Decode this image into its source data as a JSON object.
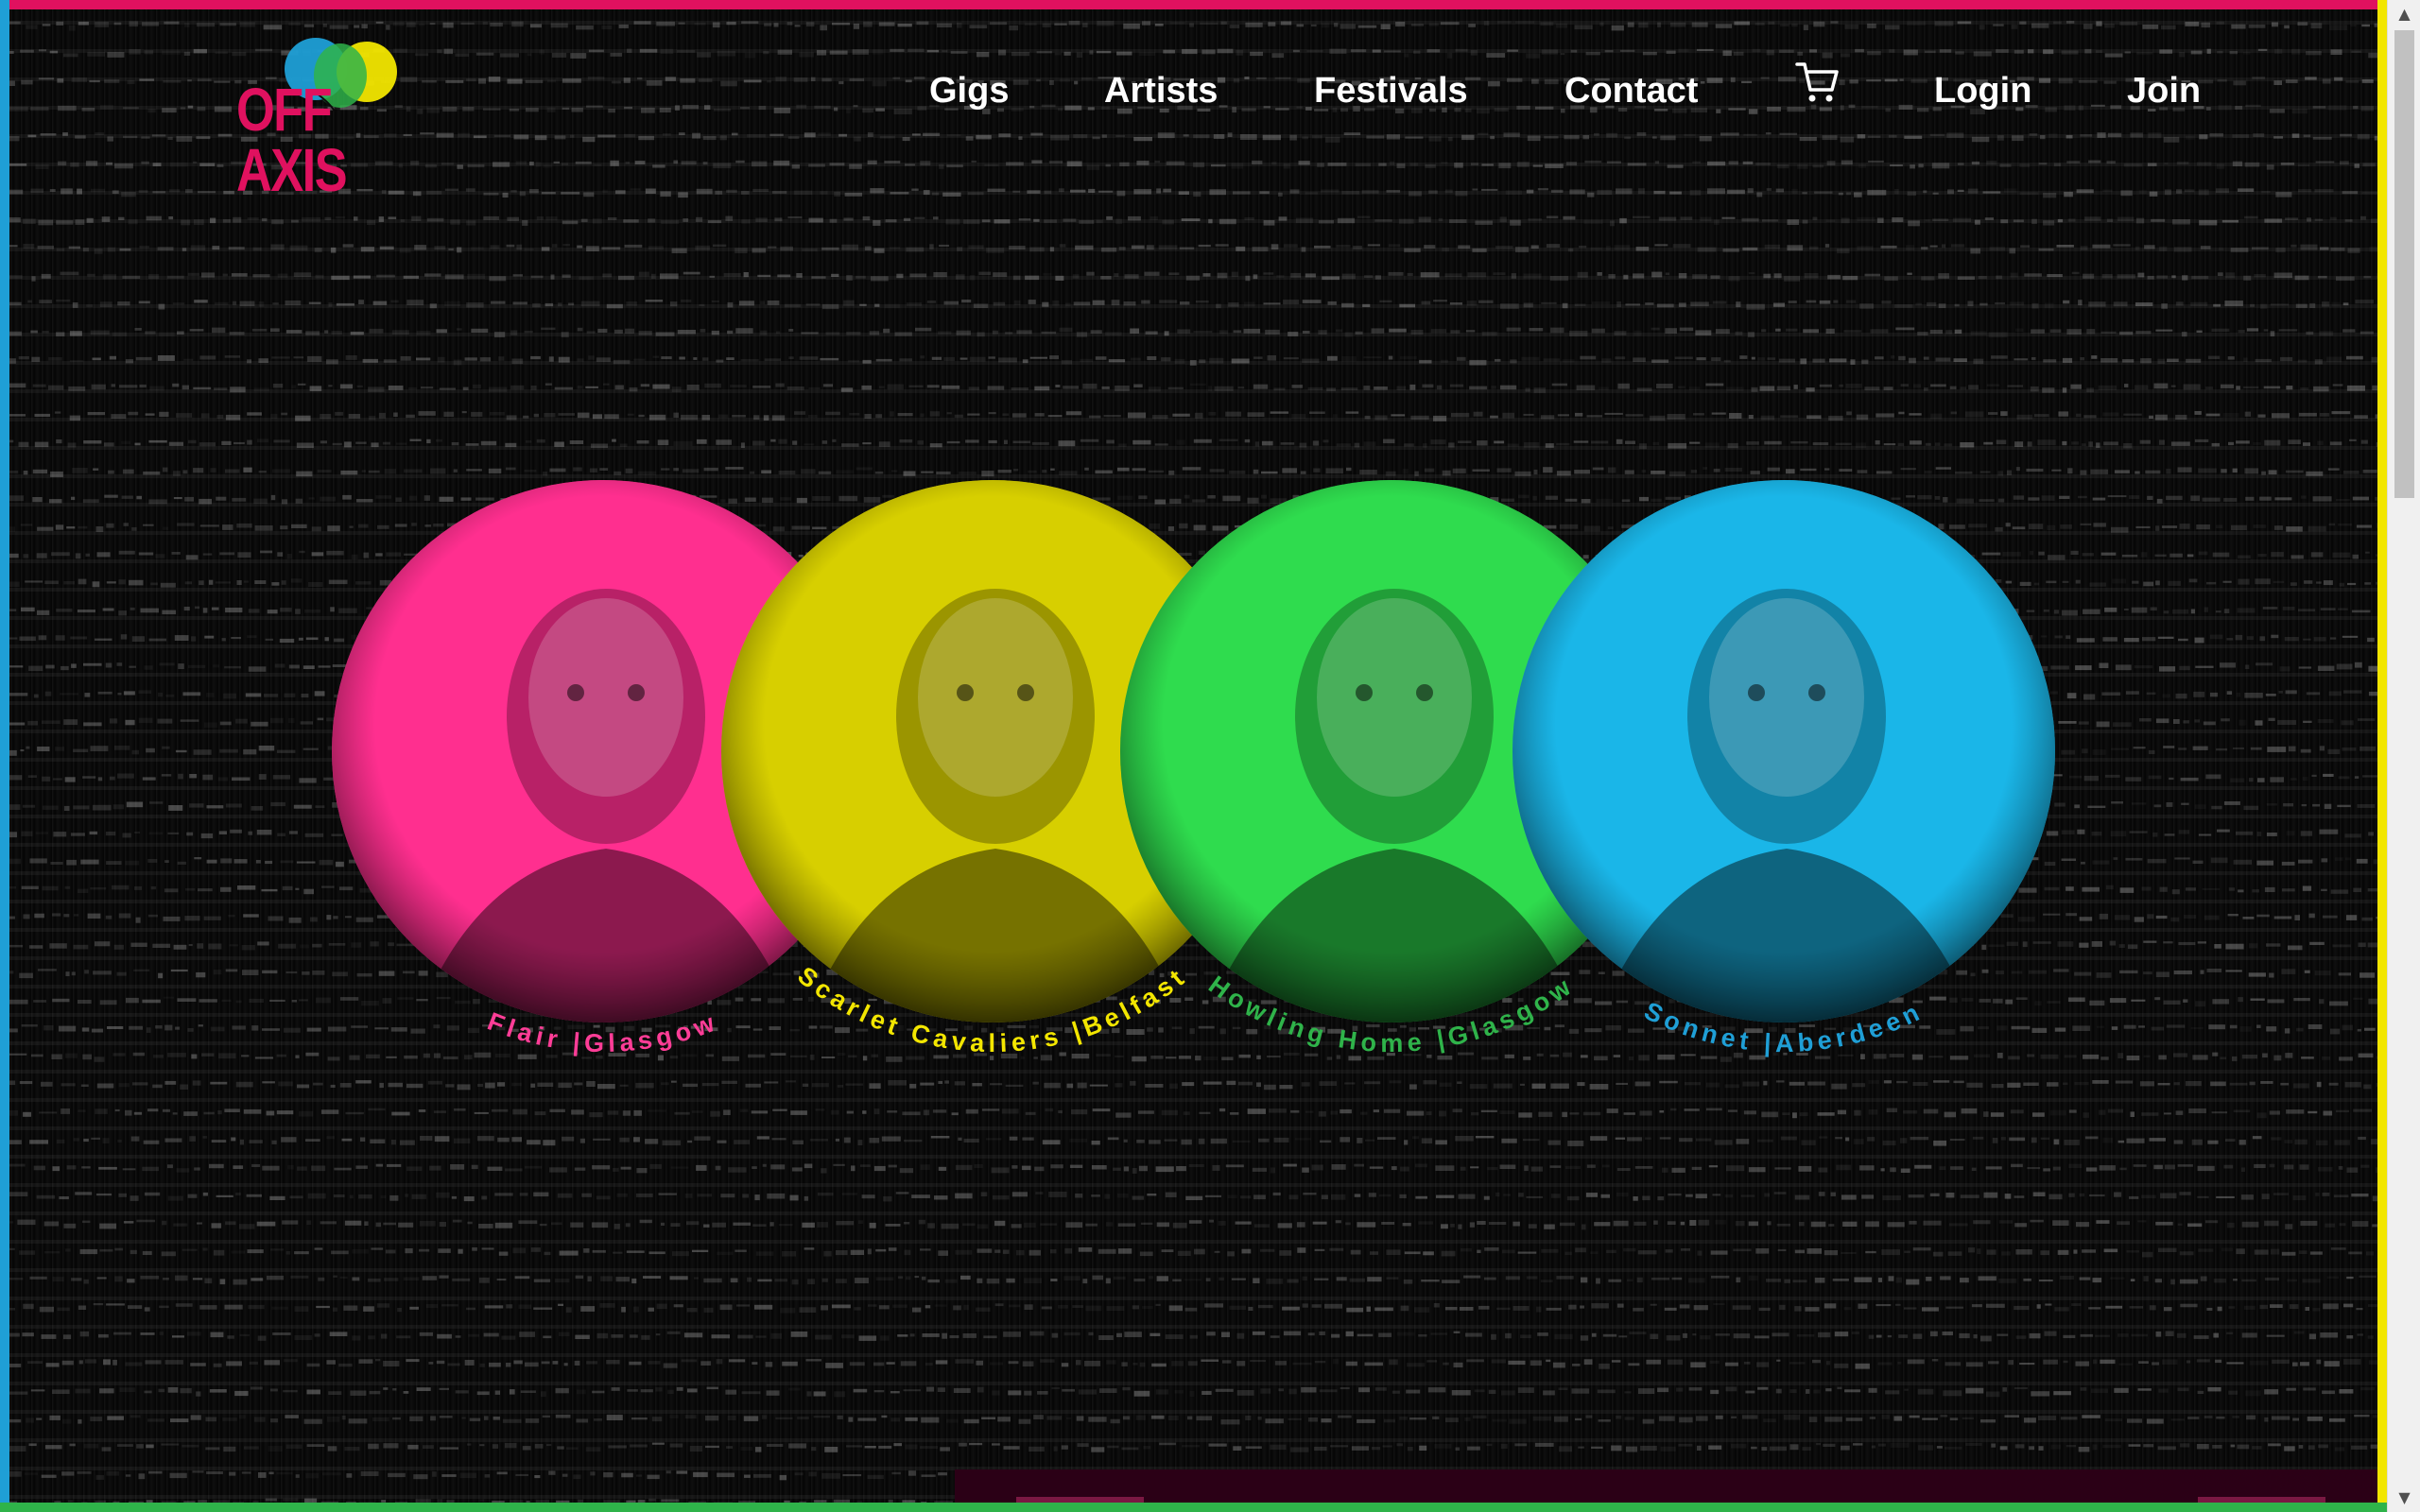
{
  "brand": {
    "name": "OFF AXIS",
    "colors": {
      "magenta": "#e0115f",
      "cyan": "#1f9fd6",
      "yellow": "#f2e600",
      "green": "#2fb34a"
    }
  },
  "nav": {
    "gigs": "Gigs",
    "artists": "Artists",
    "festivals": "Festivals",
    "contact": "Contact",
    "cart_icon": "shopping-cart-icon",
    "login": "Login",
    "join": "Join"
  },
  "featured_artists": [
    {
      "name": "Flair",
      "city": "Glasgow",
      "label": "Flair |Glasgow",
      "tint": "#ff2f8f",
      "label_color": "#ff3d97"
    },
    {
      "name": "Scarlet Cavaliers",
      "city": "Belfast",
      "label": "Scarlet Cavaliers |Belfast",
      "tint": "#d7cf00",
      "label_color": "#f3e600"
    },
    {
      "name": "Howling Home",
      "city": "Glasgow",
      "label": "Howling Home |Glasgow",
      "tint": "#2fdc4e",
      "label_color": "#2fb34a"
    },
    {
      "name": "Sonnet",
      "city": "Aberdeen",
      "label": "Sonnet |Aberdeen",
      "tint": "#1ab6e8",
      "label_color": "#1f9fd6"
    }
  ]
}
